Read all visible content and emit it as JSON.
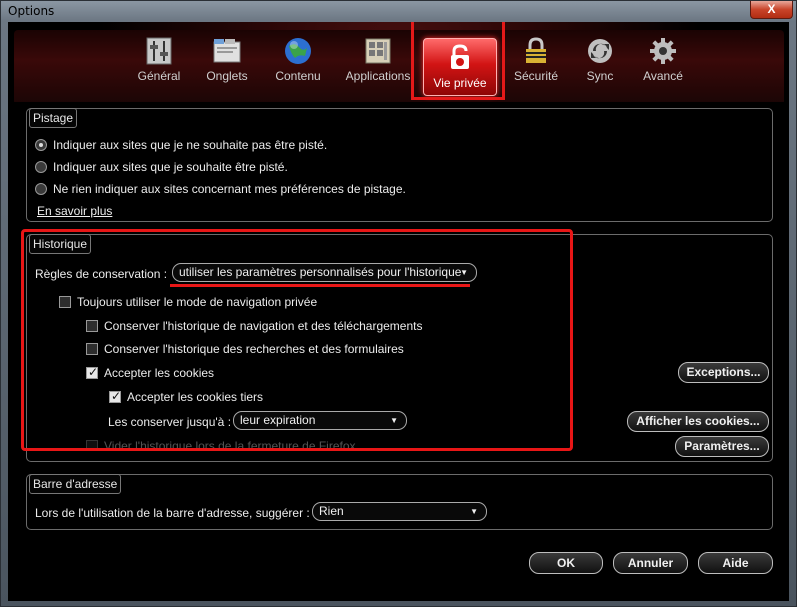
{
  "window": {
    "title": "Options",
    "close_label": "X"
  },
  "toolbar": {
    "tabs": [
      {
        "label": "Général",
        "icon": "switches-icon"
      },
      {
        "label": "Onglets",
        "icon": "tabs-icon"
      },
      {
        "label": "Contenu",
        "icon": "globe-icon"
      },
      {
        "label": "Applications",
        "icon": "applications-icon"
      },
      {
        "label": "Vie privée",
        "icon": "privacy-mask-icon",
        "active": true
      },
      {
        "label": "Sécurité",
        "icon": "lock-icon"
      },
      {
        "label": "Sync",
        "icon": "sync-icon"
      },
      {
        "label": "Avancé",
        "icon": "gear-icon"
      }
    ]
  },
  "tracking": {
    "legend": "Pistage",
    "options": [
      {
        "label": "Indiquer aux sites que je ne souhaite pas être pisté.",
        "checked": true
      },
      {
        "label": "Indiquer aux sites que je souhaite être pisté.",
        "checked": false
      },
      {
        "label": "Ne rien indiquer aux sites concernant mes préférences de pistage.",
        "checked": false
      }
    ],
    "learn_more": "En savoir plus"
  },
  "history": {
    "legend": "Historique",
    "rules_label": "Règles de conservation :",
    "rules_value": "utiliser les paramètres personnalisés pour l'historique",
    "private_mode": {
      "label": "Toujours utiliser le mode de navigation privée",
      "checked": false
    },
    "keep_browsing": {
      "label": "Conserver l'historique de navigation et des téléchargements",
      "checked": false
    },
    "keep_search": {
      "label": "Conserver l'historique des recherches et des formulaires",
      "checked": false
    },
    "accept_cookies": {
      "label": "Accepter les cookies",
      "checked": true
    },
    "accept_third_party": {
      "label": "Accepter les cookies tiers",
      "checked": true
    },
    "keep_until_label": "Les conserver jusqu'à :",
    "keep_until_value": "leur expiration",
    "exceptions_button": "Exceptions...",
    "show_cookies_button": "Afficher les cookies...",
    "settings_button": "Paramètres...",
    "clear_history_partial": "Vider l'historique lors de la fermeture de Firefox"
  },
  "address_bar": {
    "legend": "Barre d'adresse",
    "suggest_label": "Lors de l'utilisation de la barre d'adresse, suggérer :",
    "suggest_value": "Rien"
  },
  "footer": {
    "ok": "OK",
    "cancel": "Annuler",
    "help": "Aide"
  },
  "colors": {
    "accent_red": "#e41919",
    "active_tab": "#d21414"
  }
}
